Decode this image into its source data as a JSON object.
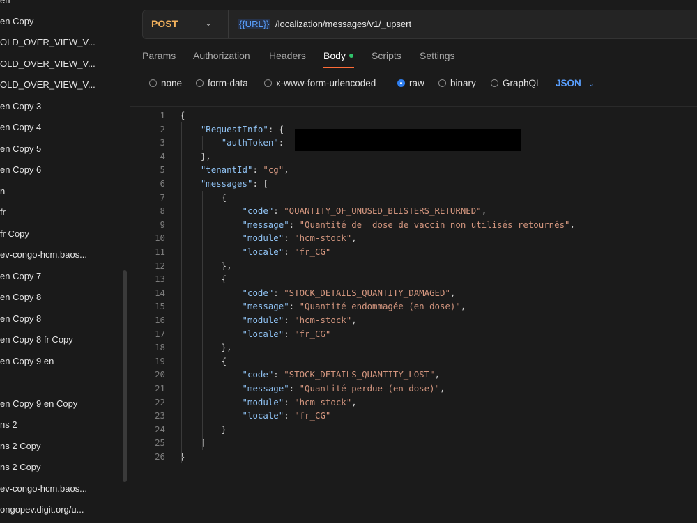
{
  "sidebar": {
    "items": [
      {
        "label": "en"
      },
      {
        "label": "en Copy"
      },
      {
        "label": "OLD_OVER_VIEW_V..."
      },
      {
        "label": "OLD_OVER_VIEW_V..."
      },
      {
        "label": "OLD_OVER_VIEW_V..."
      },
      {
        "label": "en Copy 3"
      },
      {
        "label": "en Copy 4"
      },
      {
        "label": "en Copy 5"
      },
      {
        "label": "en Copy 6"
      },
      {
        "label": "n"
      },
      {
        "label": "fr"
      },
      {
        "label": "fr Copy"
      },
      {
        "label": "ev-congo-hcm.baos..."
      },
      {
        "label": "en Copy 7"
      },
      {
        "label": "en Copy 8"
      },
      {
        "label": "en Copy 8"
      },
      {
        "label": "en Copy 8 fr Copy"
      },
      {
        "label": "en Copy 9 en"
      },
      {
        "label": ""
      },
      {
        "label": "en Copy 9 en Copy"
      },
      {
        "label": "ns 2"
      },
      {
        "label": "ns 2 Copy"
      },
      {
        "label": "ns 2 Copy"
      },
      {
        "label": "ev-congo-hcm.baos..."
      },
      {
        "label": "ongopev.digit.org/u..."
      }
    ]
  },
  "request": {
    "method": "POST",
    "url_variable": "{{URL}}",
    "url_path": "/localization/messages/v1/_upsert"
  },
  "tabs": [
    {
      "label": "Params"
    },
    {
      "label": "Authorization"
    },
    {
      "label": "Headers"
    },
    {
      "label": "Body"
    },
    {
      "label": "Scripts"
    },
    {
      "label": "Settings"
    }
  ],
  "body_types": [
    {
      "label": "none"
    },
    {
      "label": "form-data"
    },
    {
      "label": "x-www-form-urlencoded"
    },
    {
      "label": "raw"
    },
    {
      "label": "binary"
    },
    {
      "label": "GraphQL"
    }
  ],
  "body_format": "JSON",
  "colors": {
    "method": "#f2b15c",
    "accent": "#2f7ff0",
    "tab_underline": "#ff6c37",
    "body_dot": "#30c26a"
  },
  "code_lines": [
    {
      "n": "1",
      "parts": [
        {
          "t": "{",
          "c": "p"
        }
      ]
    },
    {
      "n": "2",
      "parts": [
        {
          "t": "    ",
          "c": "p"
        },
        {
          "t": "\"RequestInfo\"",
          "c": "k"
        },
        {
          "t": ": {",
          "c": "p"
        }
      ]
    },
    {
      "n": "3",
      "parts": [
        {
          "t": "        ",
          "c": "p"
        },
        {
          "t": "\"authToken\"",
          "c": "k"
        },
        {
          "t": ":",
          "c": "p"
        }
      ]
    },
    {
      "n": "4",
      "parts": [
        {
          "t": "    },",
          "c": "p"
        }
      ]
    },
    {
      "n": "5",
      "parts": [
        {
          "t": "    ",
          "c": "p"
        },
        {
          "t": "\"tenantId\"",
          "c": "k"
        },
        {
          "t": ": ",
          "c": "p"
        },
        {
          "t": "\"cg\"",
          "c": "s"
        },
        {
          "t": ",",
          "c": "p"
        }
      ]
    },
    {
      "n": "6",
      "parts": [
        {
          "t": "    ",
          "c": "p"
        },
        {
          "t": "\"messages\"",
          "c": "k"
        },
        {
          "t": ": [",
          "c": "p"
        }
      ]
    },
    {
      "n": "7",
      "parts": [
        {
          "t": "        {",
          "c": "p"
        }
      ]
    },
    {
      "n": "8",
      "parts": [
        {
          "t": "            ",
          "c": "p"
        },
        {
          "t": "\"code\"",
          "c": "k"
        },
        {
          "t": ": ",
          "c": "p"
        },
        {
          "t": "\"QUANTITY_OF_UNUSED_BLISTERS_RETURNED\"",
          "c": "s"
        },
        {
          "t": ",",
          "c": "p"
        }
      ]
    },
    {
      "n": "9",
      "parts": [
        {
          "t": "            ",
          "c": "p"
        },
        {
          "t": "\"message\"",
          "c": "k"
        },
        {
          "t": ": ",
          "c": "p"
        },
        {
          "t": "\"Quantité de  dose de vaccin non utilisés retournés\"",
          "c": "s"
        },
        {
          "t": ",",
          "c": "p"
        }
      ]
    },
    {
      "n": "10",
      "parts": [
        {
          "t": "            ",
          "c": "p"
        },
        {
          "t": "\"module\"",
          "c": "k"
        },
        {
          "t": ": ",
          "c": "p"
        },
        {
          "t": "\"hcm-stock\"",
          "c": "s"
        },
        {
          "t": ",",
          "c": "p"
        }
      ]
    },
    {
      "n": "11",
      "parts": [
        {
          "t": "            ",
          "c": "p"
        },
        {
          "t": "\"locale\"",
          "c": "k"
        },
        {
          "t": ": ",
          "c": "p"
        },
        {
          "t": "\"fr_CG\"",
          "c": "s"
        }
      ]
    },
    {
      "n": "12",
      "parts": [
        {
          "t": "        },",
          "c": "p"
        }
      ]
    },
    {
      "n": "13",
      "parts": [
        {
          "t": "        {",
          "c": "p"
        }
      ]
    },
    {
      "n": "14",
      "parts": [
        {
          "t": "            ",
          "c": "p"
        },
        {
          "t": "\"code\"",
          "c": "k"
        },
        {
          "t": ": ",
          "c": "p"
        },
        {
          "t": "\"STOCK_DETAILS_QUANTITY_DAMAGED\"",
          "c": "s"
        },
        {
          "t": ",",
          "c": "p"
        }
      ]
    },
    {
      "n": "15",
      "parts": [
        {
          "t": "            ",
          "c": "p"
        },
        {
          "t": "\"message\"",
          "c": "k"
        },
        {
          "t": ": ",
          "c": "p"
        },
        {
          "t": "\"Quantité endommagée (en dose)\"",
          "c": "s"
        },
        {
          "t": ",",
          "c": "p"
        }
      ]
    },
    {
      "n": "16",
      "parts": [
        {
          "t": "            ",
          "c": "p"
        },
        {
          "t": "\"module\"",
          "c": "k"
        },
        {
          "t": ": ",
          "c": "p"
        },
        {
          "t": "\"hcm-stock\"",
          "c": "s"
        },
        {
          "t": ",",
          "c": "p"
        }
      ]
    },
    {
      "n": "17",
      "parts": [
        {
          "t": "            ",
          "c": "p"
        },
        {
          "t": "\"locale\"",
          "c": "k"
        },
        {
          "t": ": ",
          "c": "p"
        },
        {
          "t": "\"fr_CG\"",
          "c": "s"
        }
      ]
    },
    {
      "n": "18",
      "parts": [
        {
          "t": "        },",
          "c": "p"
        }
      ]
    },
    {
      "n": "19",
      "parts": [
        {
          "t": "        {",
          "c": "p"
        }
      ]
    },
    {
      "n": "20",
      "parts": [
        {
          "t": "            ",
          "c": "p"
        },
        {
          "t": "\"code\"",
          "c": "k"
        },
        {
          "t": ": ",
          "c": "p"
        },
        {
          "t": "\"STOCK_DETAILS_QUANTITY_LOST\"",
          "c": "s"
        },
        {
          "t": ",",
          "c": "p"
        }
      ]
    },
    {
      "n": "21",
      "parts": [
        {
          "t": "            ",
          "c": "p"
        },
        {
          "t": "\"message\"",
          "c": "k"
        },
        {
          "t": ": ",
          "c": "p"
        },
        {
          "t": "\"Quantité perdue (en dose)\"",
          "c": "s"
        },
        {
          "t": ",",
          "c": "p"
        }
      ]
    },
    {
      "n": "22",
      "parts": [
        {
          "t": "            ",
          "c": "p"
        },
        {
          "t": "\"module\"",
          "c": "k"
        },
        {
          "t": ": ",
          "c": "p"
        },
        {
          "t": "\"hcm-stock\"",
          "c": "s"
        },
        {
          "t": ",",
          "c": "p"
        }
      ]
    },
    {
      "n": "23",
      "parts": [
        {
          "t": "            ",
          "c": "p"
        },
        {
          "t": "\"locale\"",
          "c": "k"
        },
        {
          "t": ": ",
          "c": "p"
        },
        {
          "t": "\"fr_CG\"",
          "c": "s"
        }
      ]
    },
    {
      "n": "24",
      "parts": [
        {
          "t": "        }",
          "c": "p"
        }
      ]
    },
    {
      "n": "25",
      "parts": [
        {
          "t": "    ]",
          "c": "p"
        }
      ]
    },
    {
      "n": "26",
      "parts": [
        {
          "t": "}",
          "c": "p"
        }
      ]
    }
  ]
}
